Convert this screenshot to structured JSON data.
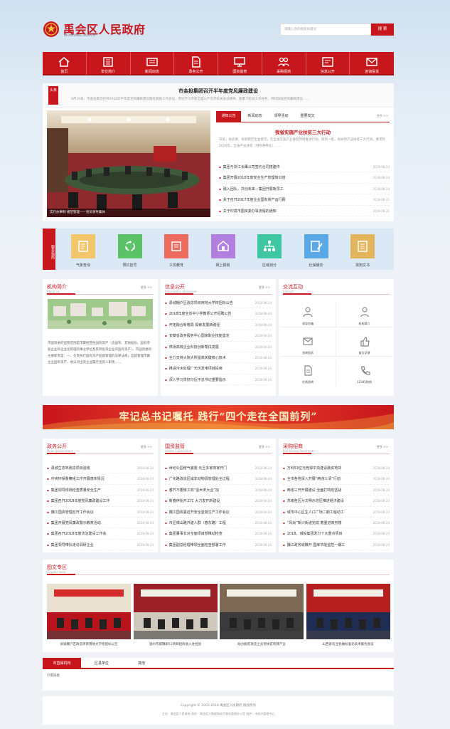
{
  "header": {
    "site_title": "禹会区人民政府",
    "site_domain": "ZHAOYANG.GOV.CN",
    "search_placeholder": "请输入你的搜索关键词",
    "search_button": "搜 索"
  },
  "nav": [
    {
      "label": "首页",
      "icon": "home-icon"
    },
    {
      "label": "单位简介",
      "icon": "building-icon"
    },
    {
      "label": "新闻动态",
      "icon": "news-icon"
    },
    {
      "label": "政务公开",
      "icon": "document-icon"
    },
    {
      "label": "国资监管",
      "icon": "monitor-icon"
    },
    {
      "label": "采购招商",
      "icon": "users-icon"
    },
    {
      "label": "信息公开",
      "icon": "info-icon"
    },
    {
      "label": "咨询投诉",
      "icon": "mail-icon"
    }
  ],
  "headline": {
    "badge": "头条",
    "title": "市金投集团召开半年度党风廉政建设",
    "summary": "8月14日，市金投集团召开2018年半年度党风廉政建设暨反腐败工作会议，传达学习市委全面从严治党有关会议精神，部署下阶段工作任务，持续加强党风廉政建设……"
  },
  "slide": {
    "caption": "实行办事制 规范管理——党员领导集体"
  },
  "news_tabs": [
    "通知公告",
    "新闻动态",
    "领导活动",
    "重要发文"
  ],
  "news_more": "更多 >>",
  "news_feature": {
    "title": "我省实施产业扶贫三大行动",
    "summary": "日前，省农委、省财政厅出台意见，在全省实施产业扶贫项目推进行动、四到一批，省扶持产业扶贫三大行动，要求到2020年，全省产业扶贫（特色种养业）……"
  },
  "news_items": [
    {
      "title": "集团与浙江长鹰公司签约合同搭建件",
      "date": "2018-08-24"
    },
    {
      "title": "集团开展2018年度安全生产管理知识培",
      "date": "2018-08-24"
    },
    {
      "title": "融入团队，共创未来—集团开展新员工",
      "date": "2018-08-24"
    },
    {
      "title": "关于召开2017年度企业国有资产运行报",
      "date": "2018-08-21"
    },
    {
      "title": "关于印发市国资委办事流程的通知",
      "date": "2018-08-21"
    }
  ],
  "services": {
    "side_label": "服务指南",
    "items": [
      {
        "label": "气象查询",
        "icon": "weather-icon",
        "color": "#f2c66b"
      },
      {
        "label": "预约挂号",
        "icon": "cycle-icon",
        "color": "#5cc268"
      },
      {
        "label": "义务教育",
        "icon": "book-icon",
        "color": "#ec6a5e"
      },
      {
        "label": "网上报税",
        "icon": "tax-icon",
        "color": "#b07fe0"
      },
      {
        "label": "区域划分",
        "icon": "tree-icon",
        "color": "#3fc7a2"
      },
      {
        "label": "社保服务",
        "icon": "pen-icon",
        "color": "#5ba8e6"
      },
      {
        "label": "常用文书",
        "icon": "doc-icon",
        "color": "#e3b55c"
      }
    ]
  },
  "org": {
    "title": "机构简介",
    "en": "About us",
    "more": "更多 >>",
    "text": "市国资委的监管范围是市属经营性国有资产（含国有、其他股份、国有参股企业和企业化管理的事业单位及其所投资企业的国有资产）。市国资委的主要职责是：一、负责执行国有资产监督管理的法律法规，监督管理市属企业国有资产，依法对出资企业履行出资人职责……"
  },
  "info": {
    "title": "信息公开",
    "en": "Information disclosure",
    "more": "更多 >>",
    "items": [
      {
        "title": "县城棚户区改造项目用地大学校招标公告",
        "date": "2018-08-24"
      },
      {
        "title": "2018年度全省中小学教师公开招聘公告",
        "date": "2018-08-24"
      },
      {
        "title": "开拓融合新格局 探索发展新路径",
        "date": "2018-08-24"
      },
      {
        "title": "安徽省政务服务中心国家职业技能鉴定",
        "date": "2018-08-24"
      },
      {
        "title": "林场高效企业科技创新帮扶发展",
        "date": "2018-08-24"
      },
      {
        "title": "全力支持大院大所提高关键核心技术",
        "date": "2018-08-24"
      },
      {
        "title": "推进污水处理厂光伏发电项目投用",
        "date": "2018-08-24"
      },
      {
        "title": "深入学习贯彻习近平总书记重要指示",
        "date": "2018-08-24"
      }
    ]
  },
  "interact": {
    "title": "交流互动",
    "en": "Interact",
    "items": [
      {
        "label": "领导信箱",
        "icon": "leader-icon"
      },
      {
        "label": "机构简介",
        "icon": "person-icon"
      },
      {
        "label": "咨询投诉",
        "icon": "mail-icon"
      },
      {
        "label": "留言反馈",
        "icon": "thumb-icon"
      },
      {
        "label": "在线咨询",
        "icon": "file-icon"
      },
      {
        "label": "12345热线",
        "icon": "phone-icon"
      }
    ]
  },
  "banner": {
    "text": "牢记总书记嘱托 践行“四个走在全国前列”"
  },
  "gov": {
    "title": "政务公开",
    "en": "Open government",
    "more": "更多 >>",
    "items": [
      {
        "title": "县城生态林改造项目验收",
        "date": "2018-08-24"
      },
      {
        "title": "中央环保督察组工作开展落实情况",
        "date": "2018-08-24"
      },
      {
        "title": "集团领导现场检查质量安全生产",
        "date": "2018-08-24"
      },
      {
        "title": "集团召开2018年度党风廉政建设工作",
        "date": "2018-08-24"
      },
      {
        "title": "魏江国资管理召开工作会议",
        "date": "2018-08-24"
      },
      {
        "title": "集团开展党风廉政警示教育活动",
        "date": "2018-08-24"
      },
      {
        "title": "集团召开2018年度法治建设工作会",
        "date": "2018-08-24"
      },
      {
        "title": "集团领导带队走访调研企业",
        "date": "2018-08-24"
      }
    ]
  },
  "assets": {
    "title": "国资监管",
    "en": "Assets supervision",
    "more": "更多 >>",
    "items": [
      {
        "title": "世纪公园增气装置 元旦多家商家开门",
        "date": "2018-08-24"
      },
      {
        "title": "广化路改造区域非动物源管理处全过程",
        "date": "2018-08-24"
      },
      {
        "title": "春节不要慌工商“蛋木宋大业”加",
        "date": "2018-08-24"
      },
      {
        "title": "新春伊始开工忙 大力发开新建设",
        "date": "2018-08-24"
      },
      {
        "title": "魏江国资委召开安全监督生产工作会议",
        "date": "2018-08-24"
      },
      {
        "title": "市区博山路开建人群（春东路）工程",
        "date": "2018-08-24"
      },
      {
        "title": "集团董事长对全面项目部推动检查",
        "date": "2018-08-24"
      },
      {
        "title": "集团副总经理带领全面检查部署工作",
        "date": "2018-08-24"
      }
    ]
  },
  "procure": {
    "title": "采购招商",
    "en": "Purchasing merchants",
    "more": "更多 >>",
    "items": [
      {
        "title": "万科53亿元竞得中央建设融资地块",
        "date": "2018-08-24"
      },
      {
        "title": "全市各地深入开展“两违三清”行动",
        "date": "2018-08-24"
      },
      {
        "title": "两违三开开展建设 全面打响攻坚战",
        "date": "2018-08-24"
      },
      {
        "title": "苏南各区为文明示范区推进经济建设",
        "date": "2018-08-24"
      },
      {
        "title": "城市中心区生人口广场二期工程动工",
        "date": "2018-08-24"
      },
      {
        "title": "“风尚”新兴街道完成 着重进商务楼",
        "date": "2018-08-24"
      },
      {
        "title": "2018，城投集团发力十大重点项目",
        "date": "2018-08-24"
      },
      {
        "title": "魏江政务城推开 国库节能监控一期工",
        "date": "2018-08-24"
      }
    ]
  },
  "gallery": {
    "title": "图文专区",
    "en": "Graphic zone",
    "items": [
      {
        "caption": "县城棚户区改造项目用地大学校招标公告"
      },
      {
        "caption": "温州市城镇新51项目招商会入驻经验"
      },
      {
        "caption": "助力脱贫攻坚之光伏扶贫项目产业"
      },
      {
        "caption": "山西省农业机械标准化技术服务会议"
      }
    ]
  },
  "links": {
    "tabs": [
      "市直属机构",
      "区县单位",
      "其他"
    ],
    "content": "只需链接"
  },
  "footer": {
    "copyright": "Copyright © 2002-2018 禹会区人民政府 版权所有",
    "info": "主办：禹会区人民政府 承办：禹会区大数据和电子政务管理办公室 维护：市经济管理中心"
  }
}
